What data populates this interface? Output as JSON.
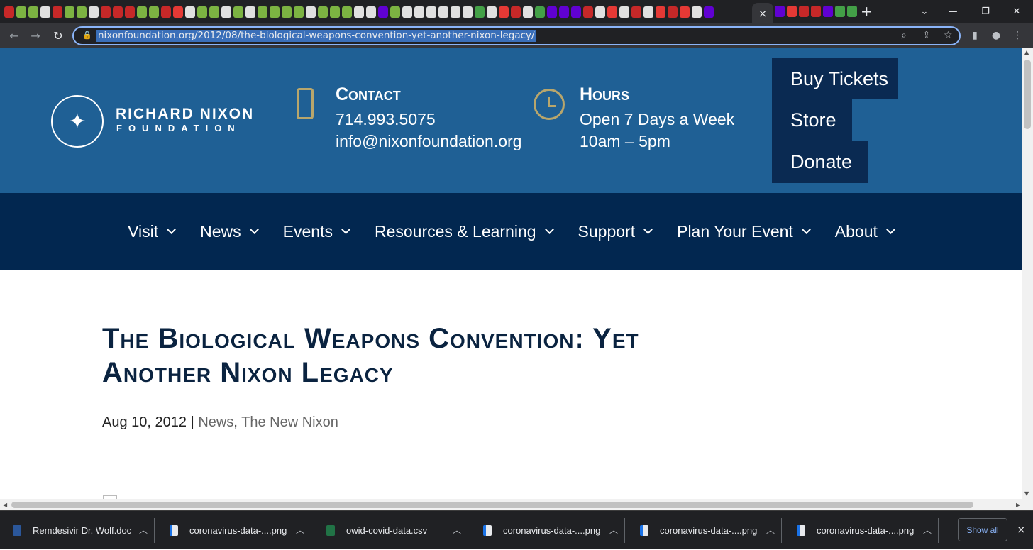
{
  "browser": {
    "url": "nixonfoundation.org/2012/08/the-biological-weapons-convention-yet-another-nixon-legacy/",
    "active_tab_close": "×",
    "new_tab": "+"
  },
  "site": {
    "logo_line1": "RICHARD NIXON",
    "logo_line2": "FOUNDATION",
    "contact": {
      "heading": "Contact",
      "phone": "714.993.5075",
      "email": "info@nixonfoundation.org"
    },
    "hours": {
      "heading": "Hours",
      "line1": "Open 7 Days a Week",
      "line2": "10am – 5pm"
    },
    "cta": {
      "buy": "Buy Tickets",
      "store": "Store",
      "donate": "Donate"
    },
    "nav": [
      {
        "label": "Visit"
      },
      {
        "label": "News"
      },
      {
        "label": "Events"
      },
      {
        "label": "Resources & Learning"
      },
      {
        "label": "Support"
      },
      {
        "label": "Plan Your Event"
      },
      {
        "label": "About"
      }
    ]
  },
  "article": {
    "title": "The Biological Weapons Convention: Yet Another Nixon Legacy",
    "date": "Aug 10, 2012",
    "separator": "|",
    "cat1": "News",
    "comma": ",",
    "cat2": "The New Nixon"
  },
  "downloads": {
    "items": [
      {
        "name": "Remdesivir Dr. Wolf.doc"
      },
      {
        "name": "coronavirus-data-....png"
      },
      {
        "name": "owid-covid-data.csv"
      },
      {
        "name": "coronavirus-data-....png"
      },
      {
        "name": "coronavirus-data-....png"
      },
      {
        "name": "coronavirus-data-....png"
      }
    ],
    "show_all": "Show all",
    "close": "×"
  }
}
